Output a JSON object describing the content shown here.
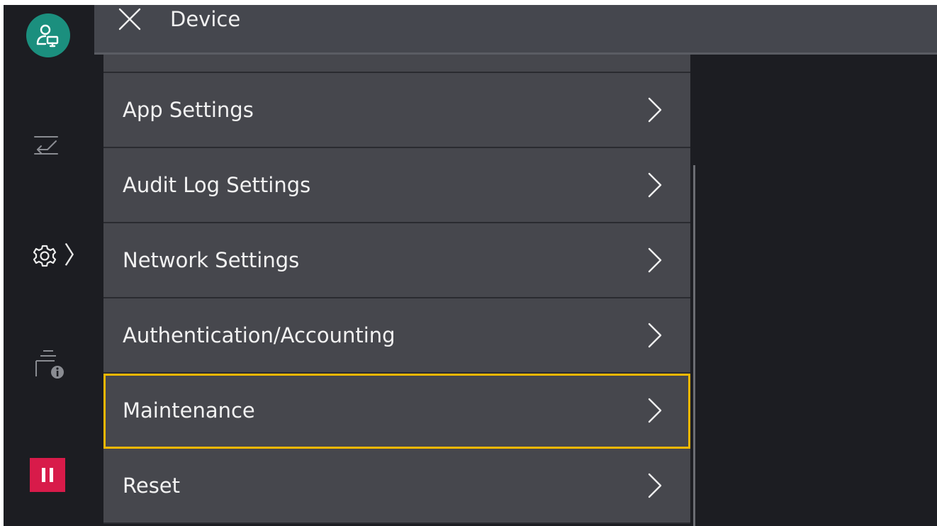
{
  "header": {
    "title": "Device",
    "close_icon": "close-icon"
  },
  "rail": {
    "avatar_icon": "user-device-icon",
    "transfer_icon": "transfer-icon",
    "settings_icon": "gear-icon",
    "settings_chevron": "〉",
    "job_info_icon": "printer-info-icon",
    "stop_icon": "pause-icon",
    "avatar_color": "#1b8f7e",
    "stop_color": "#d81b4a"
  },
  "menu": {
    "items": [
      {
        "label": "App Settings"
      },
      {
        "label": "Audit Log Settings"
      },
      {
        "label": "Network Settings"
      },
      {
        "label": "Authentication/Accounting"
      },
      {
        "label": "Maintenance",
        "selected": true
      },
      {
        "label": "Reset"
      }
    ],
    "highlight_color": "#f5b800"
  }
}
